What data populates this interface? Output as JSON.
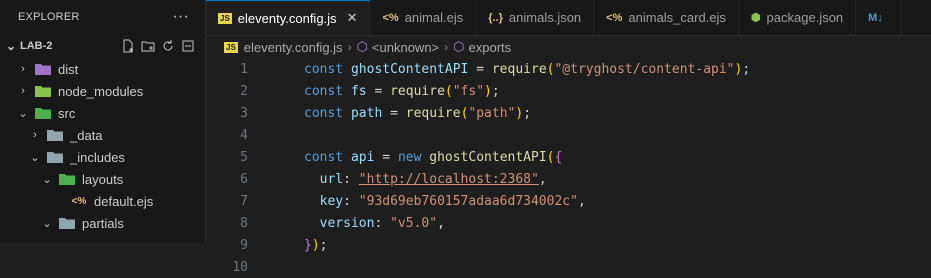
{
  "sidebar": {
    "title": "EXPLORER",
    "more": "···",
    "folder": "LAB-2",
    "items": [
      {
        "label": "dist",
        "chev": "›",
        "depth": 1,
        "icon": "dist-folder-icon",
        "color": "#a074c4"
      },
      {
        "label": "node_modules",
        "chev": "›",
        "depth": 1,
        "icon": "node-modules-folder-icon",
        "color": "#8bc34a"
      },
      {
        "label": "src",
        "chev": "⌄",
        "depth": 1,
        "icon": "src-folder-icon",
        "color": "#4caf50"
      },
      {
        "label": "_data",
        "chev": "›",
        "depth": 2,
        "icon": "folder-icon",
        "color": "#90a4ae"
      },
      {
        "label": "_includes",
        "chev": "⌄",
        "depth": 2,
        "icon": "folder-open-icon",
        "color": "#90a4ae"
      },
      {
        "label": "layouts",
        "chev": "⌄",
        "depth": 3,
        "icon": "layouts-folder-icon",
        "color": "#4caf50"
      },
      {
        "label": "default.ejs",
        "chev": "",
        "depth": 4,
        "icon": "ejs-file-icon",
        "color": "#e5c07b"
      },
      {
        "label": "partials",
        "chev": "⌄",
        "depth": 3,
        "icon": "folder-open-icon",
        "color": "#90a4ae"
      }
    ]
  },
  "tabs": [
    {
      "label": "eleventy.config.js",
      "icon": "JS",
      "active": true
    },
    {
      "label": "animal.ejs",
      "icon": "<%",
      "active": false
    },
    {
      "label": "animals.json",
      "icon": "{..}",
      "active": false
    },
    {
      "label": "animals_card.ejs",
      "icon": "<%",
      "active": false
    },
    {
      "label": "package.json",
      "icon": "⬢",
      "active": false
    },
    {
      "label": "",
      "icon": "M↓",
      "active": false
    }
  ],
  "breadcrumb": {
    "file": "eleventy.config.js",
    "unknown": "<unknown>",
    "exports": "exports"
  },
  "editor": {
    "line_numbers": [
      "1",
      "2",
      "3",
      "4",
      "5",
      "6",
      "7",
      "8",
      "9",
      "10"
    ],
    "tokens": {
      "const": "const",
      "ghostContentAPI": "ghostContentAPI",
      "eq": " = ",
      "require": "require",
      "pkg_ghost": "\"@tryghost/content-api\"",
      "fs": "fs",
      "pkg_fs": "\"fs\"",
      "path": "path",
      "pkg_path": "\"path\"",
      "api": "api",
      "new": "new",
      "url_key": "url",
      "url_val": "\"http://localhost:2368\"",
      "key_key": "key",
      "key_val": "\"93d69eb760157adaa6d734002c\"",
      "version_key": "version",
      "version_val": "\"v5.0\""
    }
  }
}
